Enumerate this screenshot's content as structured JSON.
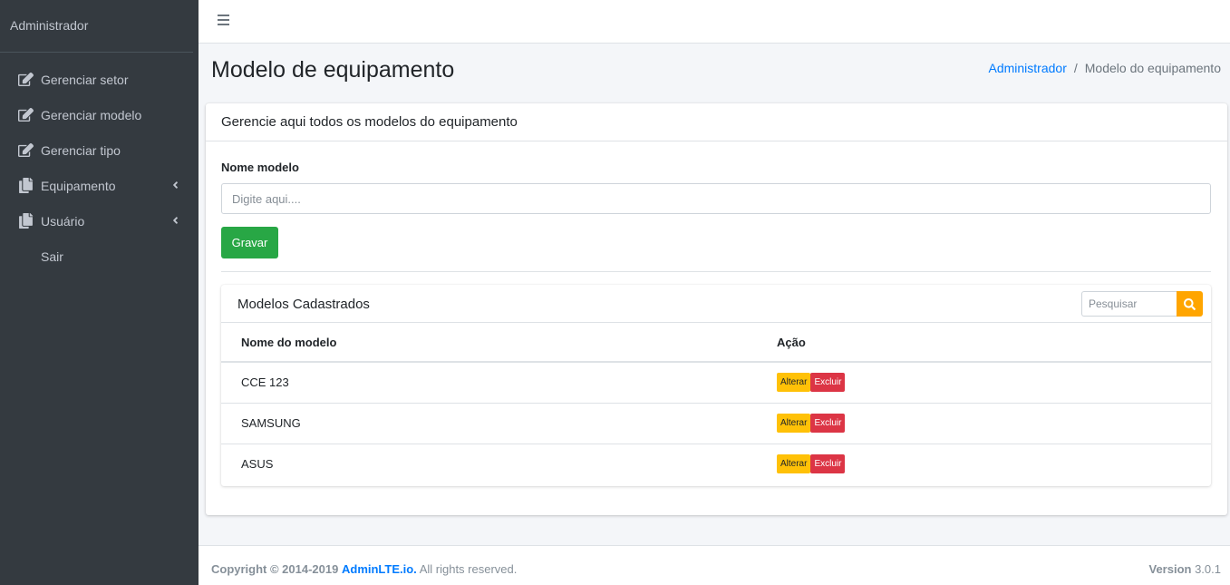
{
  "sidebar": {
    "brand": "Administrador",
    "items": [
      {
        "label": "Gerenciar setor",
        "icon": "edit-icon"
      },
      {
        "label": "Gerenciar modelo",
        "icon": "edit-icon"
      },
      {
        "label": "Gerenciar tipo",
        "icon": "edit-icon"
      },
      {
        "label": "Equipamento",
        "icon": "copy-icon"
      },
      {
        "label": "Usuário",
        "icon": "copy-icon"
      },
      {
        "label": "Sair",
        "icon": ""
      }
    ]
  },
  "header": {
    "title": "Modelo de equipamento",
    "breadcrumb": [
      "Administrador",
      "Modelo do equipamento"
    ]
  },
  "card": {
    "header": "Gerencie aqui todos os modelos do equipamento",
    "field_label": "Nome modelo",
    "field_placeholder": "Digite aqui....",
    "field_value": "",
    "save_label": "Gravar"
  },
  "list": {
    "title": "Modelos Cadastrados",
    "search_placeholder": "Pesquisar",
    "columns": [
      "Nome do modelo",
      "Ação"
    ],
    "rows": [
      {
        "name": "CCE 123"
      },
      {
        "name": "SAMSUNG"
      },
      {
        "name": "ASUS"
      }
    ],
    "edit_label": "Alterar",
    "delete_label": "Excluir"
  },
  "footer": {
    "copyright": "Copyright © 2014-2019",
    "brand_link": "AdminLTE.io.",
    "rights": "All rights reserved.",
    "version_label": "Version",
    "version": "3.0.1"
  },
  "colors": {
    "sidebar": "#343a40",
    "primary": "#007bff",
    "success": "#28a745",
    "warning": "#ffc107",
    "danger": "#dc3545",
    "search": "#ffa500"
  }
}
